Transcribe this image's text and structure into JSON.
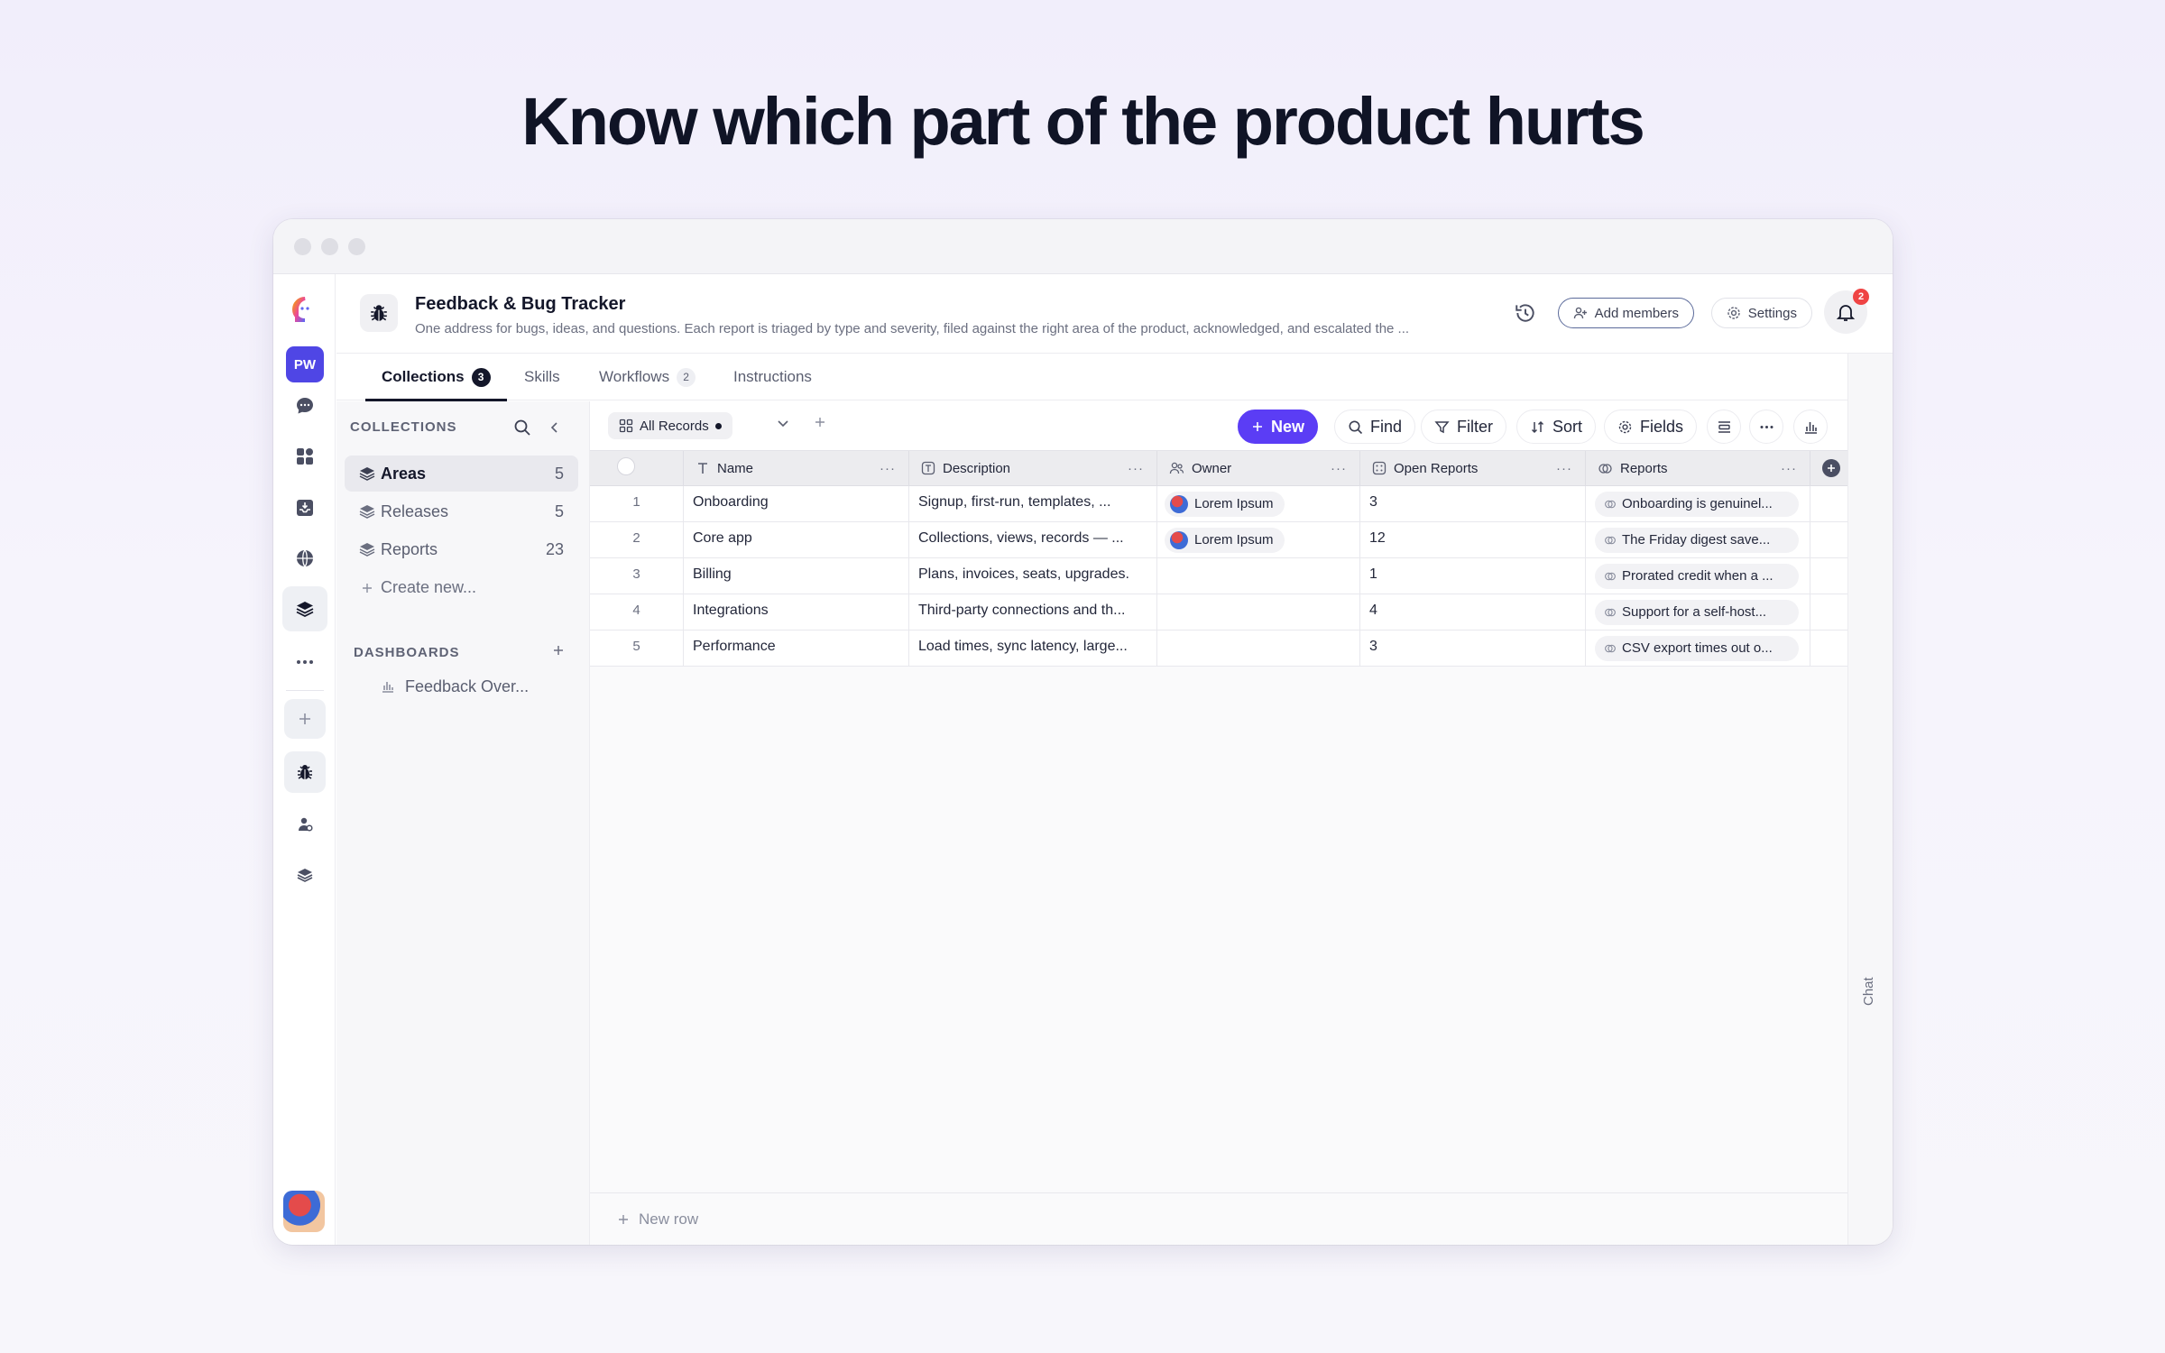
{
  "headline": "Know which part of the product hurts",
  "rail": {
    "workspace_initials": "PW",
    "icons": [
      "logo-icon",
      "chat-icon",
      "apps-icon",
      "inbox-icon",
      "globe-icon",
      "layers-icon",
      "more-icon",
      "plus-icon",
      "bug-icon",
      "agent-icon",
      "stack-icon"
    ]
  },
  "project": {
    "title": "Feedback & Bug Tracker",
    "description": "One address for bugs, ideas, and questions. Each report is triaged by type and severity, filed against the right area of the product, acknowledged, and escalated the ...",
    "add_members_label": "Add members",
    "settings_label": "Settings",
    "notification_count": "2"
  },
  "tabs": [
    {
      "label": "Collections",
      "count": "3"
    },
    {
      "label": "Skills",
      "count": ""
    },
    {
      "label": "Workflows",
      "count": "2"
    },
    {
      "label": "Instructions",
      "count": ""
    }
  ],
  "collections": {
    "section_title": "COLLECTIONS",
    "items": [
      {
        "label": "Areas",
        "count": "5"
      },
      {
        "label": "Releases",
        "count": "5"
      },
      {
        "label": "Reports",
        "count": "23"
      }
    ],
    "create_new_label": "Create new..."
  },
  "dashboards": {
    "section_title": "DASHBOARDS",
    "items": [
      {
        "label": "Feedback Over..."
      }
    ]
  },
  "toolbar": {
    "view_label": "All Records",
    "new_label": "New",
    "find_label": "Find",
    "filter_label": "Filter",
    "sort_label": "Sort",
    "fields_label": "Fields"
  },
  "table": {
    "columns": [
      {
        "label": "Name",
        "icon": "text-icon"
      },
      {
        "label": "Description",
        "icon": "longtext-icon"
      },
      {
        "label": "Owner",
        "icon": "people-icon"
      },
      {
        "label": "Open Reports",
        "icon": "number-icon"
      },
      {
        "label": "Reports",
        "icon": "link-icon"
      }
    ],
    "rows": [
      {
        "num": "1",
        "name": "Onboarding",
        "description": "Signup, first-run, templates, ...",
        "owner": "Lorem Ipsum",
        "open_reports": "3",
        "reports": "Onboarding is genuinel..."
      },
      {
        "num": "2",
        "name": "Core app",
        "description": "Collections, views, records — ...",
        "owner": "Lorem Ipsum",
        "open_reports": "12",
        "reports": "The Friday digest save..."
      },
      {
        "num": "3",
        "name": "Billing",
        "description": "Plans, invoices, seats, upgrades.",
        "owner": "",
        "open_reports": "1",
        "reports": "Prorated credit when a ..."
      },
      {
        "num": "4",
        "name": "Integrations",
        "description": "Third-party connections and th...",
        "owner": "",
        "open_reports": "4",
        "reports": "Support for a self-host..."
      },
      {
        "num": "5",
        "name": "Performance",
        "description": "Load times, sync latency, large...",
        "owner": "",
        "open_reports": "3",
        "reports": "CSV export times out o..."
      }
    ],
    "new_row_label": "New row"
  },
  "chat_label": "Chat"
}
